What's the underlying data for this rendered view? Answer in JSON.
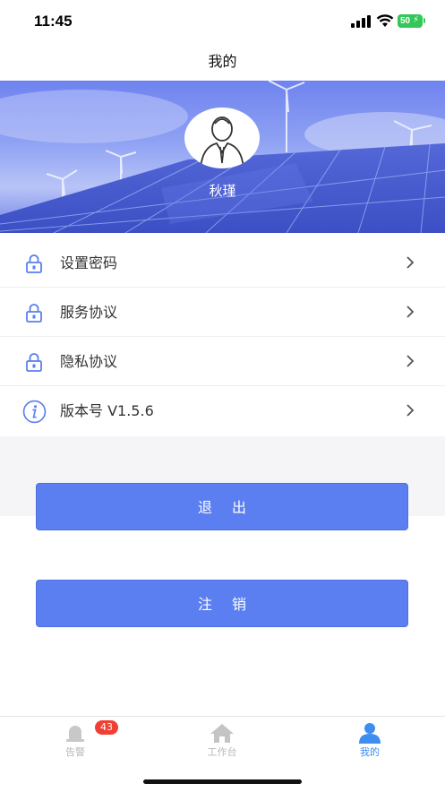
{
  "status_bar": {
    "time": "11:45",
    "battery": "50"
  },
  "nav": {
    "title": "我的"
  },
  "profile": {
    "name": "秋瑾"
  },
  "menu": {
    "items": [
      {
        "label": "设置密码",
        "icon": "lock-icon"
      },
      {
        "label": "服务协议",
        "icon": "lock-icon"
      },
      {
        "label": "隐私协议",
        "icon": "lock-icon"
      },
      {
        "label": "版本号 V1.5.6",
        "icon": "info-icon"
      }
    ]
  },
  "buttons": {
    "logout": "退出",
    "cancel_account": "注销"
  },
  "tab_bar": {
    "tabs": [
      {
        "label": "告警",
        "badge": "43",
        "icon": "bell-icon",
        "active": false
      },
      {
        "label": "工作台",
        "icon": "home-icon",
        "active": false
      },
      {
        "label": "我的",
        "icon": "person-icon",
        "active": true
      }
    ]
  },
  "colors": {
    "accent": "#5b7ff0",
    "active_tab": "#3d8ef0",
    "badge": "#f04034",
    "icon": "#5b7ff0"
  }
}
